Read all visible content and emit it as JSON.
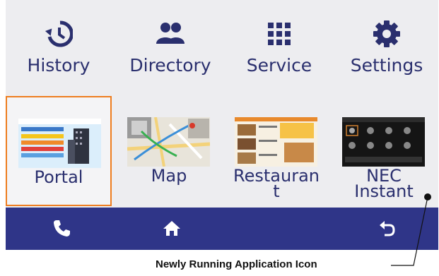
{
  "nav": {
    "history": {
      "label": "History",
      "icon": "history-icon"
    },
    "directory": {
      "label": "Directory",
      "icon": "people-icon"
    },
    "service": {
      "label": "Service",
      "icon": "grid-icon"
    },
    "settings": {
      "label": "Settings",
      "icon": "gear-icon"
    }
  },
  "apps": [
    {
      "name": "Portal",
      "selected": true
    },
    {
      "name": "Map",
      "selected": false
    },
    {
      "name": "Restauran\nt",
      "selected": false
    },
    {
      "name": "NEC\nInstant",
      "selected": false
    }
  ],
  "bottom_bar": {
    "buttons": [
      "phone-icon",
      "home-icon",
      "back-icon"
    ]
  },
  "annotation": {
    "text": "Newly Running Application Icon"
  },
  "colors": {
    "accent_text": "#2a2f6e",
    "bottom_bar": "#2f3588",
    "selection_border": "#ee7d1f",
    "background": "#ededf0"
  }
}
